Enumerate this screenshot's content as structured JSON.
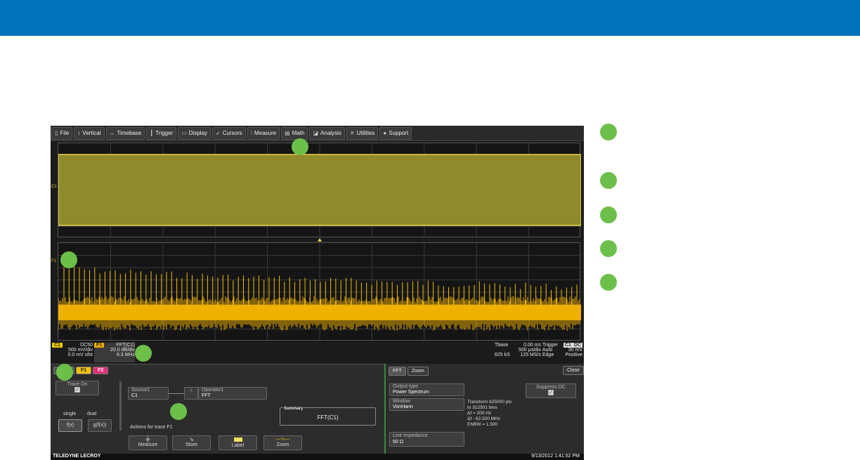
{
  "menubar": {
    "items": [
      {
        "label": "File",
        "icon": "file-icon",
        "glyph": "▯"
      },
      {
        "label": "Vertical",
        "icon": "vertical-arrows-icon",
        "glyph": "↕"
      },
      {
        "label": "Timebase",
        "icon": "horizontal-arrows-icon",
        "glyph": "↔"
      },
      {
        "label": "Trigger",
        "icon": "trigger-icon",
        "glyph": "┃"
      },
      {
        "label": "Display",
        "icon": "display-icon",
        "glyph": "▭"
      },
      {
        "label": "Cursors",
        "icon": "cursor-icon",
        "glyph": "➶"
      },
      {
        "label": "Measure",
        "icon": "measure-icon",
        "glyph": "⁞"
      },
      {
        "label": "Math",
        "icon": "calculator-icon",
        "glyph": "▤"
      },
      {
        "label": "Analysis",
        "icon": "analysis-icon",
        "glyph": "◪"
      },
      {
        "label": "Utilities",
        "icon": "tools-icon",
        "glyph": "✕"
      },
      {
        "label": "Support",
        "icon": "support-icon",
        "glyph": "●"
      }
    ]
  },
  "grid": {
    "c1_marker": "C1",
    "f1_marker": "F1"
  },
  "channel_c1": {
    "tag": "C1",
    "coupling": "DC50",
    "volts_per_div": "500 mV/div",
    "offset": "0.0 mV ofst",
    "color": "#f0d000"
  },
  "function_f1": {
    "tag": "F1",
    "name": "FFT(C1)",
    "db_per_div": "20.0 dB/div",
    "freq": "6.3 MHz",
    "color": "#f0b000"
  },
  "timebase": {
    "label": "Tbase",
    "delay": "0.00 ms",
    "time_per_div": "500 µs/div",
    "samples": "625 kS",
    "rate": "125 MS/s"
  },
  "trigger": {
    "label": "Trigger",
    "channel": "C1",
    "coupling": "DC",
    "mode": "Auto",
    "level": "30 mV",
    "type": "Edge",
    "slope": "Positive"
  },
  "panel": {
    "tab_f1": "F1",
    "tab_f2": "F2",
    "trace_on": "Trace On",
    "single": "single",
    "dual": "dual",
    "fx": "f(x)",
    "gfx": "g(f(x))",
    "source_label": "Source1",
    "source_value": "C1",
    "operator_label": "Operator1",
    "operator_value": "FFT",
    "summary_label": "Summary",
    "summary_value": "FFT(C1)",
    "actions_label": "Actions for trace F1",
    "action_measure": "Measure",
    "action_store": "Store",
    "action_label": "Label",
    "action_zoom": "Zoom"
  },
  "fft_panel": {
    "tab_fft": "FFT",
    "tab_zoom": "Zoom",
    "close": "Close",
    "output_type_label": "Output type",
    "output_type_value": "Power Spectrum",
    "window_label": "Window",
    "window_value": "VonHann",
    "suppress_dc": "Suppress DC",
    "info_line1": "Transform 625000 pts",
    "info_line2": "to 312501 bins",
    "info_line3": "Δf = 200 Hz",
    "info_line4": "Δf - 62.500 MHz",
    "info_line5": "ENBW = 1.500",
    "line_impedance_label": "Line Impedance",
    "line_impedance_value": "50 Ω"
  },
  "footer": {
    "brand": "TELEDYNE LECROY",
    "datetime": "9/13/2012 1:41:52 PM"
  },
  "colors": {
    "header_blue": "#0072bc",
    "callout_green": "#6cc04a",
    "trace_yellow": "#f0d000",
    "fft_yellow": "#f0b000"
  }
}
